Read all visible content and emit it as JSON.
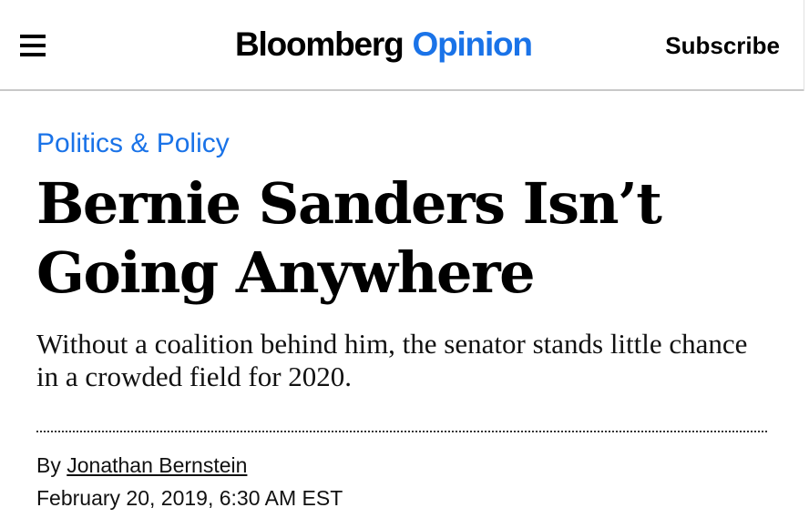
{
  "header": {
    "menu_icon": "hamburger-menu-icon",
    "logo_brand": "Bloomberg",
    "logo_section": "Opinion",
    "subscribe_label": "Subscribe"
  },
  "article": {
    "category": "Politics & Policy",
    "headline_line1": "Bernie Sanders Isn’t",
    "headline_line2": "Going Anywhere",
    "dek": "Without a coalition behind him, the senator stands little chance in a crowded field for 2020.",
    "byline_prefix": "By",
    "author": "Jonathan Bernstein",
    "date": "February 20, 2019, 6:30 AM EST"
  },
  "colors": {
    "accent": "#1a73e8",
    "text": "#000000",
    "divider": "#c8c8c8"
  }
}
